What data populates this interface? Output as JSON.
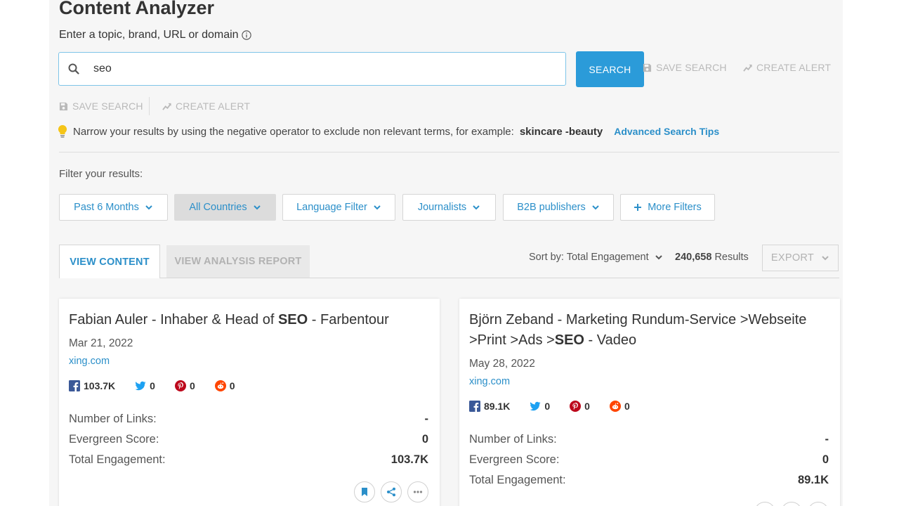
{
  "header": {
    "title": "Content Analyzer",
    "subtitle": "Enter a topic, brand, URL or domain"
  },
  "search": {
    "value": "seo",
    "button_label": "SEARCH",
    "save_search": "SAVE SEARCH",
    "create_alert": "CREATE ALERT"
  },
  "tip": {
    "text": "Narrow your results by using the negative operator to exclude non relevant terms, for example:",
    "example": "skincare -beauty",
    "link": "Advanced Search Tips"
  },
  "filters": {
    "label": "Filter your results:",
    "items": [
      {
        "label": "Past 6 Months"
      },
      {
        "label": "All Countries"
      },
      {
        "label": "Language Filter"
      },
      {
        "label": "Journalists"
      },
      {
        "label": "B2B publishers"
      }
    ],
    "more": "More Filters"
  },
  "tabs": {
    "view_content": "VIEW CONTENT",
    "view_analysis": "VIEW ANALYSIS REPORT"
  },
  "toolbar": {
    "sort_label": "Sort by: Total Engagement",
    "results_count": "240,658",
    "results_label": "Results",
    "export_label": "EXPORT"
  },
  "cards": [
    {
      "title_pre": "Fabian Auler - Inhaber & Head of ",
      "title_bold": "SEO",
      "title_post": " - Farbentour",
      "date": "Mar 21, 2022",
      "domain": "xing.com",
      "facebook": "103.7K",
      "twitter": "0",
      "pinterest": "0",
      "reddit": "0",
      "links_label": "Number of Links:",
      "links_value": "-",
      "evergreen_label": "Evergreen Score:",
      "evergreen_value": "0",
      "engagement_label": "Total Engagement:",
      "engagement_value": "103.7K"
    },
    {
      "title_pre": "Björn Zeband - Marketing Rundum-Service >Webseite >Print >Ads >",
      "title_bold": "SEO",
      "title_post": " - Vadeo",
      "date": "May 28, 2022",
      "domain": "xing.com",
      "facebook": "89.1K",
      "twitter": "0",
      "pinterest": "0",
      "reddit": "0",
      "links_label": "Number of Links:",
      "links_value": "-",
      "evergreen_label": "Evergreen Score:",
      "evergreen_value": "0",
      "engagement_label": "Total Engagement:",
      "engagement_value": "89.1K"
    }
  ],
  "colors": {
    "accent": "#2b9bd9",
    "link": "#2b8fc9",
    "background": "#f6f6f6",
    "facebook": "#3b5998",
    "twitter": "#1da1f2",
    "pinterest": "#bd081c",
    "reddit": "#ff4500"
  },
  "icons": {
    "info": "info-icon",
    "search": "search-icon",
    "save": "floppy-disk-icon",
    "alert": "trending-up-icon",
    "tip": "lightbulb-icon",
    "chevron": "chevron-down-icon",
    "plus": "plus-icon",
    "bookmark": "bookmark-icon",
    "share": "share-icon",
    "more": "more-icon"
  }
}
